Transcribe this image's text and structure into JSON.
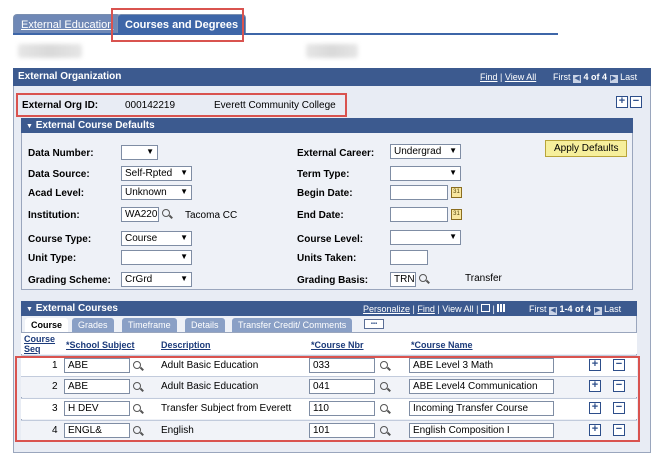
{
  "tabs": [
    {
      "label": "External Education"
    },
    {
      "label": "Courses and Degrees"
    }
  ],
  "ext_org": {
    "title": "External Organization",
    "find": "Find",
    "view_all": "View All",
    "first": "First",
    "counter": "4 of 4",
    "last": "Last",
    "id_label": "External Org ID:",
    "id_value": "000142219",
    "name": "Everett Community College"
  },
  "defaults": {
    "title": "External Course Defaults",
    "apply_label": "Apply Defaults",
    "data_number_label": "Data Number:",
    "data_number_value": "",
    "data_source_label": "Data Source:",
    "data_source_value": "Self-Rpted",
    "acad_level_label": "Acad Level:",
    "acad_level_value": "Unknown",
    "institution_label": "Institution:",
    "institution_value": "WA220",
    "institution_name": "Tacoma CC",
    "course_type_label": "Course Type:",
    "course_type_value": "Course",
    "unit_type_label": "Unit Type:",
    "unit_type_value": "",
    "grading_scheme_label": "Grading Scheme:",
    "grading_scheme_value": "CrGrd",
    "ext_career_label": "External Career:",
    "ext_career_value": "Undergrad",
    "term_type_label": "Term Type:",
    "term_type_value": "",
    "begin_date_label": "Begin Date:",
    "end_date_label": "End Date:",
    "course_level_label": "Course Level:",
    "course_level_value": "",
    "units_taken_label": "Units Taken:",
    "grading_basis_label": "Grading Basis:",
    "grading_basis_value": "TRN",
    "grading_basis_desc": "Transfer"
  },
  "courses": {
    "title": "External Courses",
    "personalize": "Personalize",
    "find": "Find",
    "view_all": "View All",
    "first": "First",
    "counter": "1-4 of 4",
    "last": "Last",
    "grid_tabs": [
      "Course",
      "Grades",
      "Timeframe",
      "Details",
      "Transfer Credit/ Comments"
    ],
    "columns": {
      "seq": "Course Seq",
      "school_subject": "*School Subject",
      "description": "Description",
      "course_nbr": "*Course Nbr",
      "course_name": "*Course Name"
    },
    "rows": [
      {
        "seq": "1",
        "subject": "ABE",
        "description": "Adult Basic Education",
        "nbr": "033",
        "name": "ABE Level 3 Math"
      },
      {
        "seq": "2",
        "subject": "ABE",
        "description": "Adult Basic Education",
        "nbr": "041",
        "name": "ABE Level4 Communication"
      },
      {
        "seq": "3",
        "subject": "H DEV",
        "description": "Transfer Subject from Everett",
        "nbr": "110",
        "name": "Incoming Transfer Course"
      },
      {
        "seq": "4",
        "subject": "ENGL&",
        "description": "English",
        "nbr": "101",
        "name": "English Composition I"
      }
    ]
  }
}
